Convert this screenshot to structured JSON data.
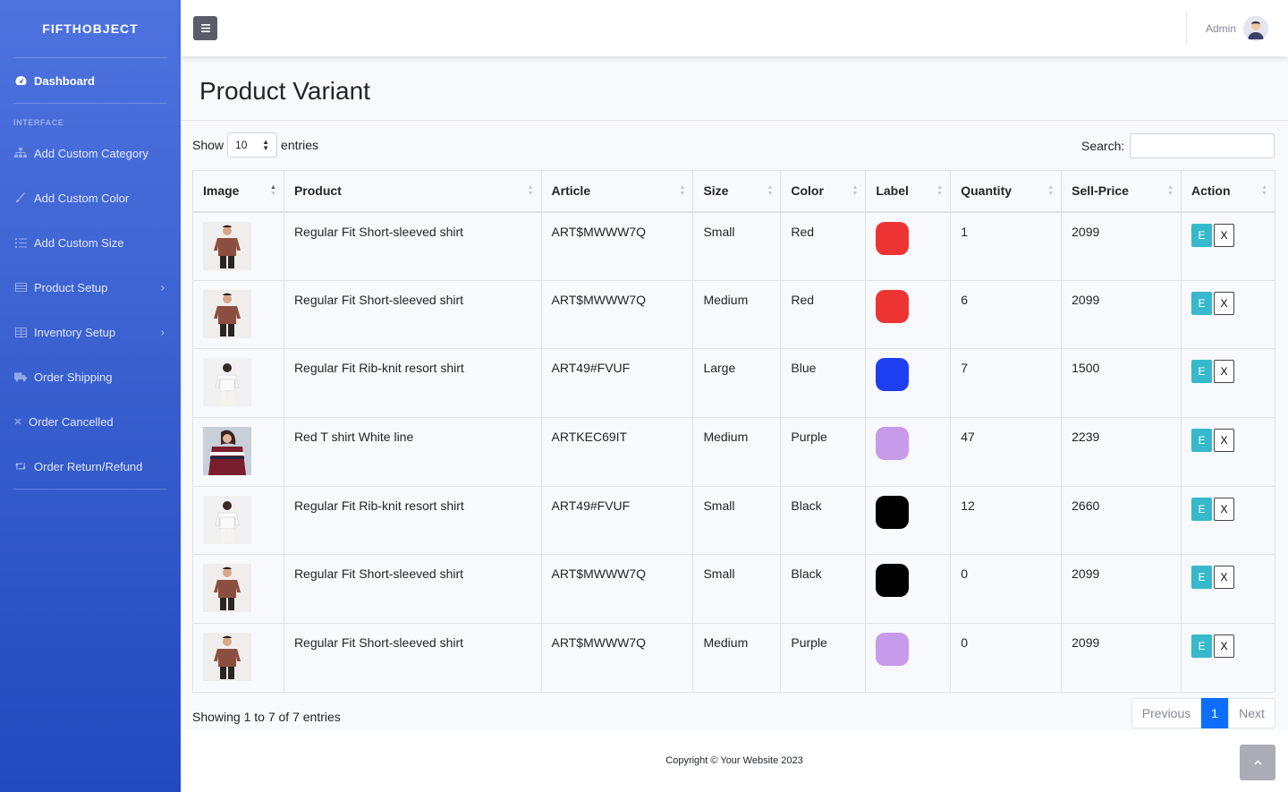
{
  "brand": "FIFTHOBJECT",
  "sidebar": {
    "dashboard": "Dashboard",
    "heading": "INTERFACE",
    "items": [
      {
        "label": "Add Custom Category",
        "icon": "sitemap-icon"
      },
      {
        "label": "Add Custom Color",
        "icon": "brush-icon"
      },
      {
        "label": "Add Custom Size",
        "icon": "list-icon"
      },
      {
        "label": "Product Setup",
        "icon": "table-icon",
        "has_submenu": true
      },
      {
        "label": "Inventory Setup",
        "icon": "grid-icon",
        "has_submenu": true
      },
      {
        "label": "Order Shipping",
        "icon": "truck-icon"
      },
      {
        "label": "Order Cancelled",
        "icon": "close-icon"
      },
      {
        "label": "Order Return/Refund",
        "icon": "retweet-icon"
      }
    ]
  },
  "topbar": {
    "user": "Admin"
  },
  "page": {
    "title": "Product Variant"
  },
  "controls": {
    "show_label": "Show",
    "entries_value": "10",
    "entries_label": "entries",
    "search_label": "Search:",
    "search_value": ""
  },
  "table": {
    "columns": [
      "Image",
      "Product",
      "Article",
      "Size",
      "Color",
      "Label",
      "Quantity",
      "Sell-Price",
      "Action"
    ],
    "rows": [
      {
        "image": "brown-shirt",
        "product": "Regular Fit Short-sleeved shirt",
        "article": "ART$MWWW7Q",
        "size": "Small",
        "color": "Red",
        "label_color": "#ee3433",
        "quantity": "1",
        "price": "2099"
      },
      {
        "image": "brown-shirt",
        "product": "Regular Fit Short-sleeved shirt",
        "article": "ART$MWWW7Q",
        "size": "Medium",
        "color": "Red",
        "label_color": "#ee3433",
        "quantity": "6",
        "price": "2099"
      },
      {
        "image": "white-shirt",
        "product": "Regular Fit Rib-knit resort shirt",
        "article": "ART49#FVUF",
        "size": "Large",
        "color": "Blue",
        "label_color": "#1e3ff0",
        "quantity": "7",
        "price": "1500"
      },
      {
        "image": "striped-tee",
        "product": "Red T shirt White line",
        "article": "ARTKEC69IT",
        "size": "Medium",
        "color": "Purple",
        "label_color": "#c89aea",
        "quantity": "47",
        "price": "2239"
      },
      {
        "image": "white-shirt",
        "product": "Regular Fit Rib-knit resort shirt",
        "article": "ART49#FVUF",
        "size": "Small",
        "color": "Black",
        "label_color": "#000000",
        "quantity": "12",
        "price": "2660"
      },
      {
        "image": "brown-shirt",
        "product": "Regular Fit Short-sleeved shirt",
        "article": "ART$MWWW7Q",
        "size": "Small",
        "color": "Black",
        "label_color": "#000000",
        "quantity": "0",
        "price": "2099"
      },
      {
        "image": "brown-shirt",
        "product": "Regular Fit Short-sleeved shirt",
        "article": "ART$MWWW7Q",
        "size": "Medium",
        "color": "Purple",
        "label_color": "#c89aea",
        "quantity": "0",
        "price": "2099"
      }
    ],
    "edit_label": "E",
    "delete_label": "X"
  },
  "footer_info": "Showing 1 to 7 of 7 entries",
  "pagination": {
    "previous": "Previous",
    "current": "1",
    "next": "Next"
  },
  "copyright": "Copyright © Your Website 2023",
  "colors": {
    "sidebar_top": "#4e73df",
    "sidebar_bottom": "#224abe",
    "edit_button": "#36b9cc",
    "page_active": "#0d6efd"
  }
}
